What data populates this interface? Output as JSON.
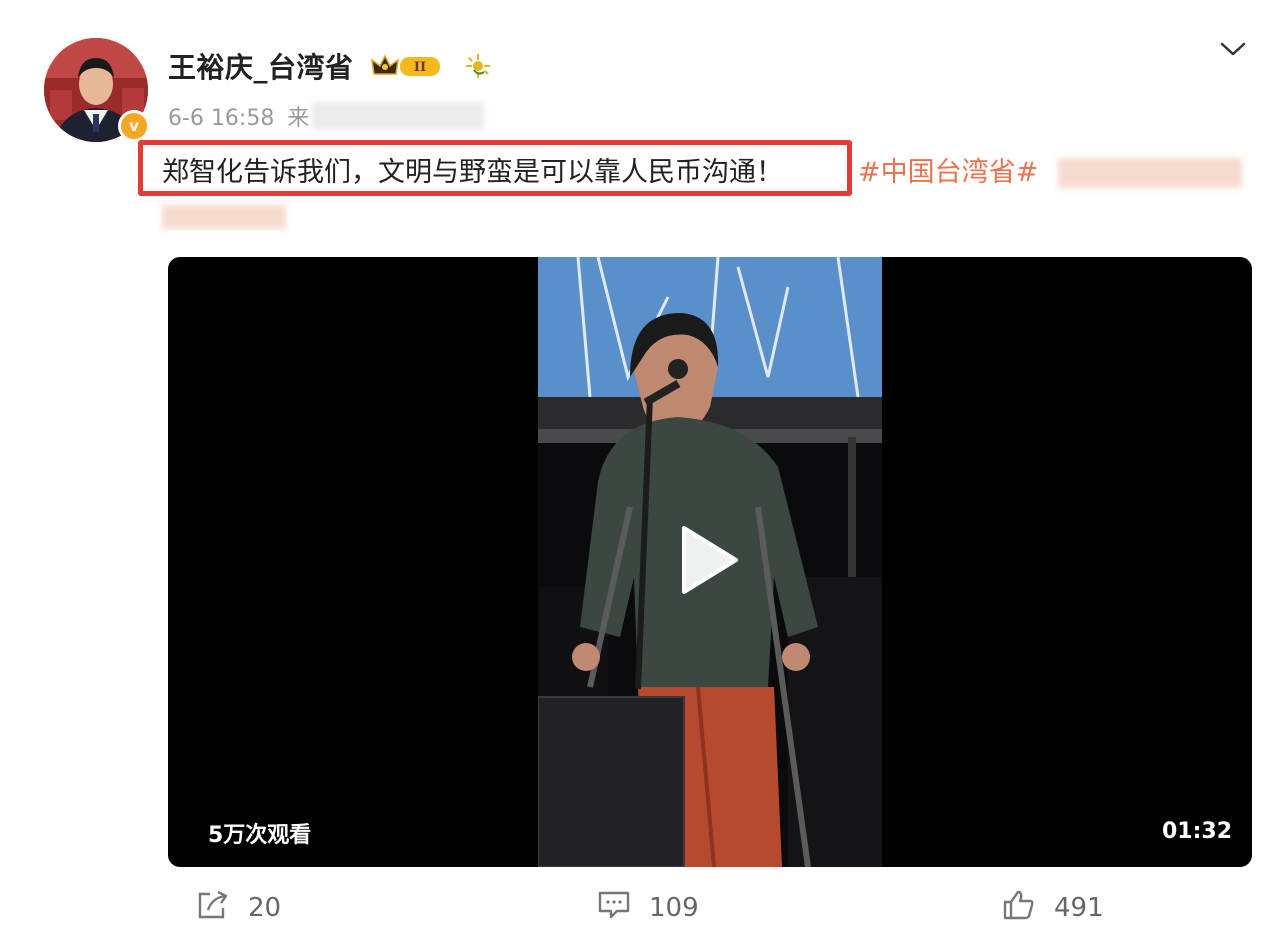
{
  "author": {
    "name": "王裕庆_台湾省",
    "level_badge": "II",
    "verified_mark": "v",
    "timestamp": "6-6 16:58",
    "timestamp_suffix": "来"
  },
  "post": {
    "text": "郑智化告诉我们，文明与野蛮是可以靠人民币沟通！",
    "hashtag": "#中国台湾省#"
  },
  "video": {
    "views": "5万次观看",
    "duration": "01:32"
  },
  "actions": {
    "share_count": "20",
    "comment_count": "109",
    "like_count": "491"
  },
  "colors": {
    "accent": "#eb7350",
    "highlight_border": "#e33a3a",
    "verified": "#f5a623"
  },
  "icons": [
    "chevron-down-icon",
    "crown-badge-icon",
    "sun-badge-icon",
    "play-icon",
    "share-icon",
    "comment-icon",
    "like-icon"
  ]
}
